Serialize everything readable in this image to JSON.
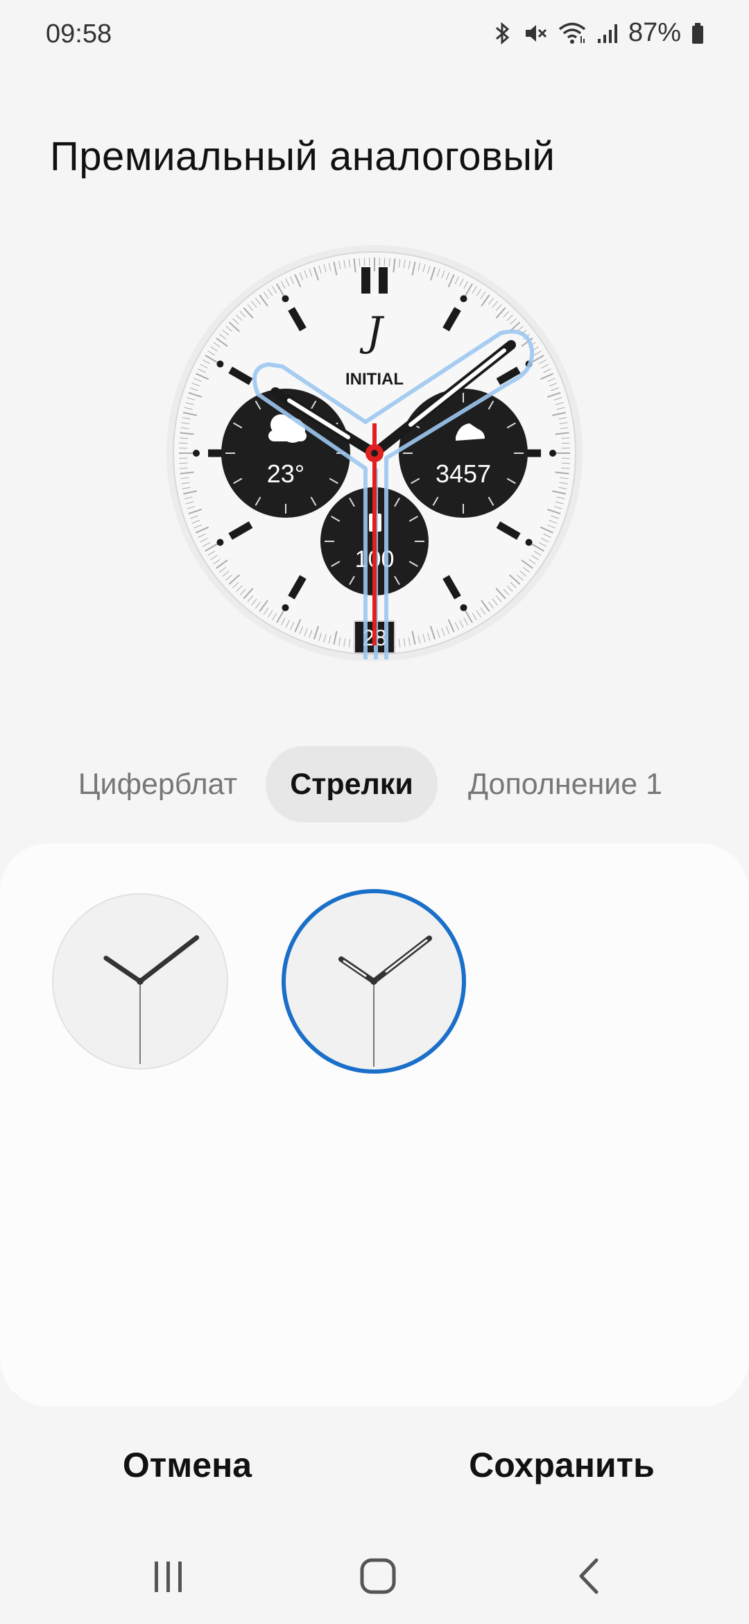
{
  "status": {
    "time": "09:58",
    "battery": "87%",
    "icons": [
      "bluetooth-icon",
      "mute-icon",
      "wifi-icon",
      "signal-icon",
      "battery-icon"
    ]
  },
  "page": {
    "title": "Премиальный аналоговый"
  },
  "watch": {
    "monogram": "J",
    "brand": "INITIAL",
    "weather_temp": "23°",
    "steps": "3457",
    "battery_value": "100",
    "date": "28",
    "colors": {
      "second_hand": "#e02020",
      "highlight": "#9cc8f0",
      "subdial": "#1e1e1e"
    }
  },
  "tabs": [
    {
      "label": "Циферблат",
      "active": false
    },
    {
      "label": "Стрелки",
      "active": true
    },
    {
      "label": "Дополнение 1",
      "active": false
    }
  ],
  "hand_options": [
    {
      "name": "solid-hands",
      "selected": false
    },
    {
      "name": "outline-hands",
      "selected": true
    }
  ],
  "buttons": {
    "cancel": "Отмена",
    "save": "Сохранить"
  },
  "nav": {
    "icons": [
      "recents-icon",
      "home-icon",
      "back-icon"
    ]
  },
  "accent": "#1a6fc9"
}
